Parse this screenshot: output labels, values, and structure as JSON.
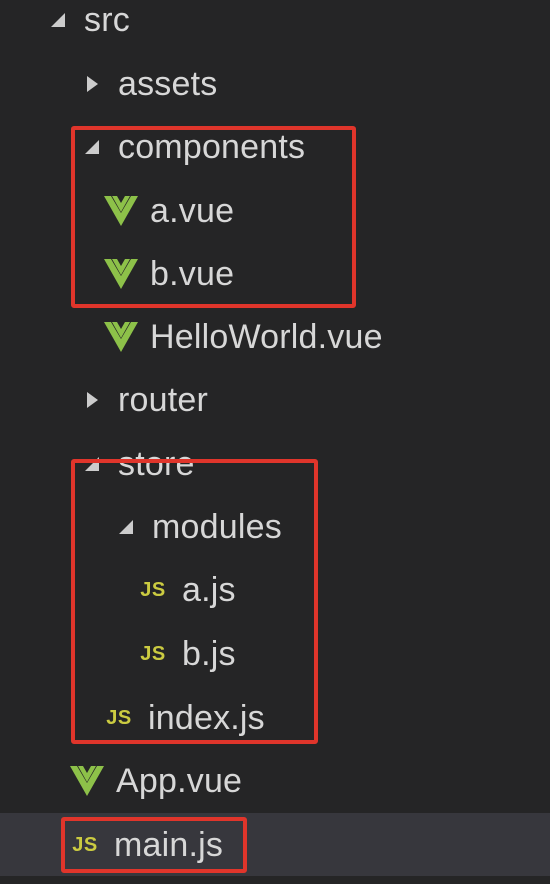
{
  "explorer": {
    "items": [
      {
        "label": "src",
        "type": "folder",
        "expanded": true,
        "depth": 0
      },
      {
        "label": "assets",
        "type": "folder",
        "expanded": false,
        "depth": 1
      },
      {
        "label": "components",
        "type": "folder",
        "expanded": true,
        "depth": 1
      },
      {
        "label": "a.vue",
        "type": "file",
        "icon": "vue-icon",
        "depth": 2
      },
      {
        "label": "b.vue",
        "type": "file",
        "icon": "vue-icon",
        "depth": 2
      },
      {
        "label": "HelloWorld.vue",
        "type": "file",
        "icon": "vue-icon",
        "depth": 2
      },
      {
        "label": "router",
        "type": "folder",
        "expanded": false,
        "depth": 1
      },
      {
        "label": "store",
        "type": "folder",
        "expanded": true,
        "depth": 1
      },
      {
        "label": "modules",
        "type": "folder",
        "expanded": true,
        "depth": 2
      },
      {
        "label": "a.js",
        "type": "file",
        "icon": "js-icon",
        "depth": 3
      },
      {
        "label": "b.js",
        "type": "file",
        "icon": "js-icon",
        "depth": 3
      },
      {
        "label": "index.js",
        "type": "file",
        "icon": "js-icon",
        "depth": 2
      },
      {
        "label": "App.vue",
        "type": "file",
        "icon": "vue-icon",
        "depth": 1
      },
      {
        "label": "main.js",
        "type": "file",
        "icon": "js-icon",
        "depth": 1,
        "selected": true
      }
    ],
    "js_icon_text": "JS"
  },
  "colors": {
    "background": "#252526",
    "selected_row": "#37373d",
    "text": "#d7d7d7",
    "vue_green": "#8dc149",
    "js_yellow": "#cbcb41",
    "annotation_red": "#e0352b"
  }
}
